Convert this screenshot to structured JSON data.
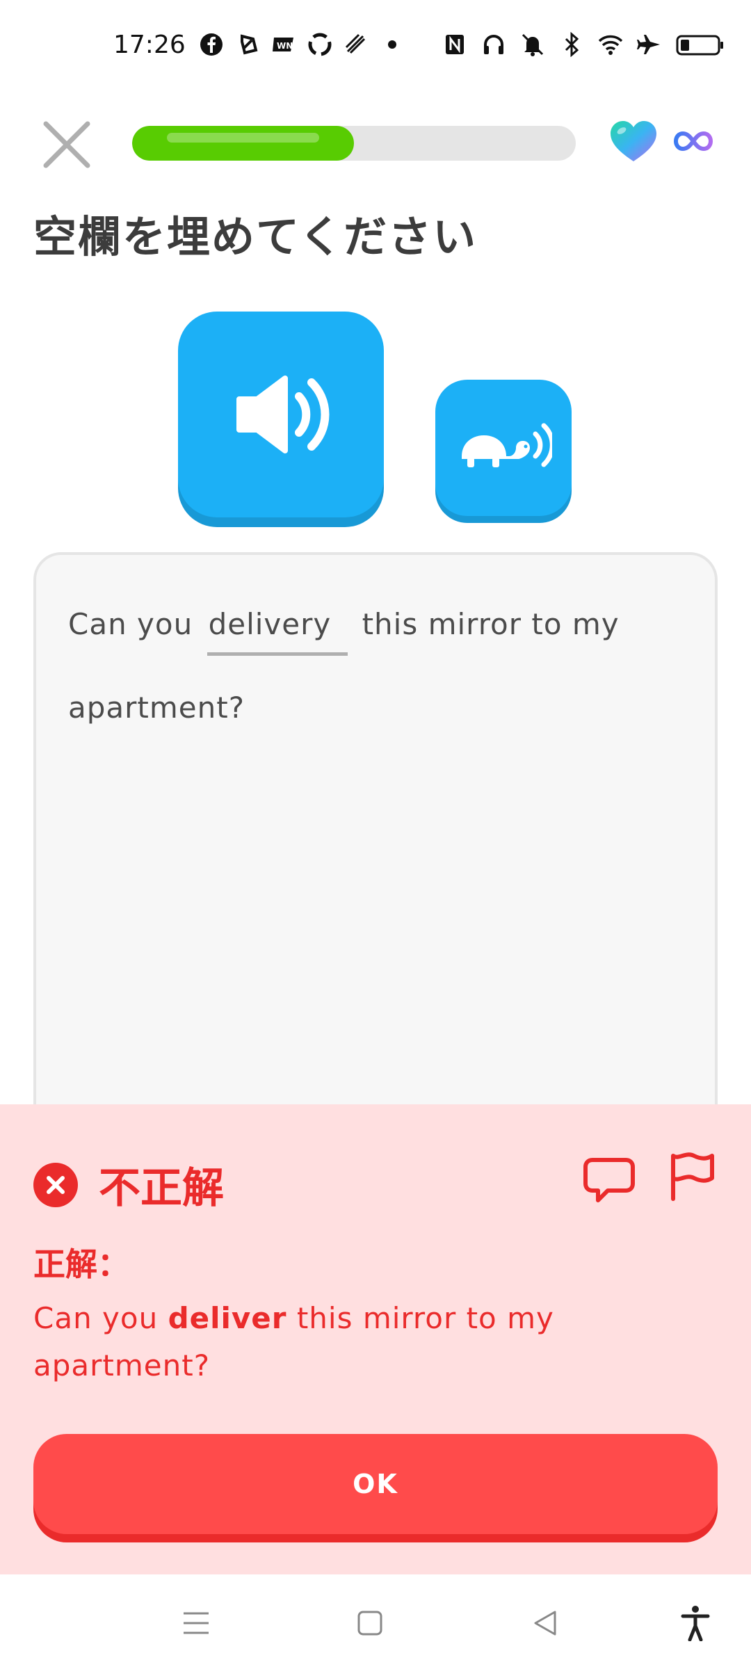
{
  "status_bar": {
    "time": "17:26",
    "left_icons": [
      "facebook-icon",
      "app-icon",
      "wn-icon",
      "swirl-icon",
      "grid-icon",
      "dot-icon"
    ],
    "right_icons": [
      "nfc-icon",
      "headphones-icon",
      "mute-icon",
      "bluetooth-icon",
      "wifi-icon",
      "airplane-icon",
      "battery-icon"
    ]
  },
  "header": {
    "progress_fraction": 0.5,
    "hearts_label": "infinite"
  },
  "prompt": {
    "title": "空欄を埋めてください"
  },
  "sentence": {
    "before": "Can you",
    "filled": "delivery",
    "after_line1": "this mirror to my",
    "line2": "apartment?"
  },
  "feedback": {
    "title": "不正解",
    "label": "正解：",
    "answer_before": "Can you ",
    "answer_highlight": "deliver",
    "answer_after": " this mirror to my apartment?",
    "ok_label": "OK"
  },
  "colors": {
    "accent_blue": "#1cb0f6",
    "progress_green": "#58cc02",
    "error_red": "#ea2b2b",
    "feedback_bg": "#ffdfe0"
  }
}
